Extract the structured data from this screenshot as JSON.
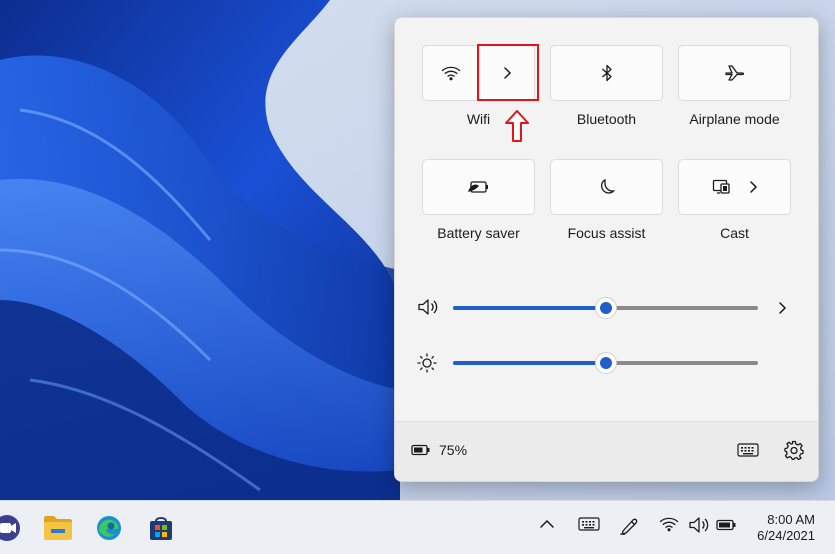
{
  "quick_settings": {
    "tiles": [
      {
        "id": "wifi",
        "label": "Wifi",
        "icon": "wifi-icon",
        "expand_icon": "chevron-right-icon"
      },
      {
        "id": "bluetooth",
        "label": "Bluetooth",
        "icon": "bluetooth-icon"
      },
      {
        "id": "airplane",
        "label": "Airplane mode",
        "icon": "airplane-icon"
      },
      {
        "id": "battery_saver",
        "label": "Battery saver",
        "icon": "battery-saver-icon"
      },
      {
        "id": "focus_assist",
        "label": "Focus assist",
        "icon": "moon-icon"
      },
      {
        "id": "cast",
        "label": "Cast",
        "icon": "cast-icon",
        "expand_icon": "chevron-right-icon"
      }
    ],
    "volume": {
      "icon": "speaker-icon",
      "level_percent": 50
    },
    "brightness": {
      "icon": "sun-icon",
      "level_percent": 50
    },
    "footer": {
      "battery_percent": "75%",
      "icons": [
        "battery-icon",
        "keyboard-icon",
        "gear-icon"
      ]
    }
  },
  "taskbar": {
    "pinned_apps": [
      "camera-icon",
      "file-explorer-icon",
      "edge-icon",
      "store-icon"
    ],
    "tray_icons": [
      "chevron-up-icon",
      "keyboard-icon",
      "pen-icon",
      "wifi-icon",
      "speaker-icon",
      "battery-icon"
    ],
    "time": "8:00 AM",
    "date": "6/24/2021"
  },
  "colors": {
    "accent": "#1f5fc7",
    "annotation": "#e0161b",
    "panel": "#f3f3f3"
  }
}
